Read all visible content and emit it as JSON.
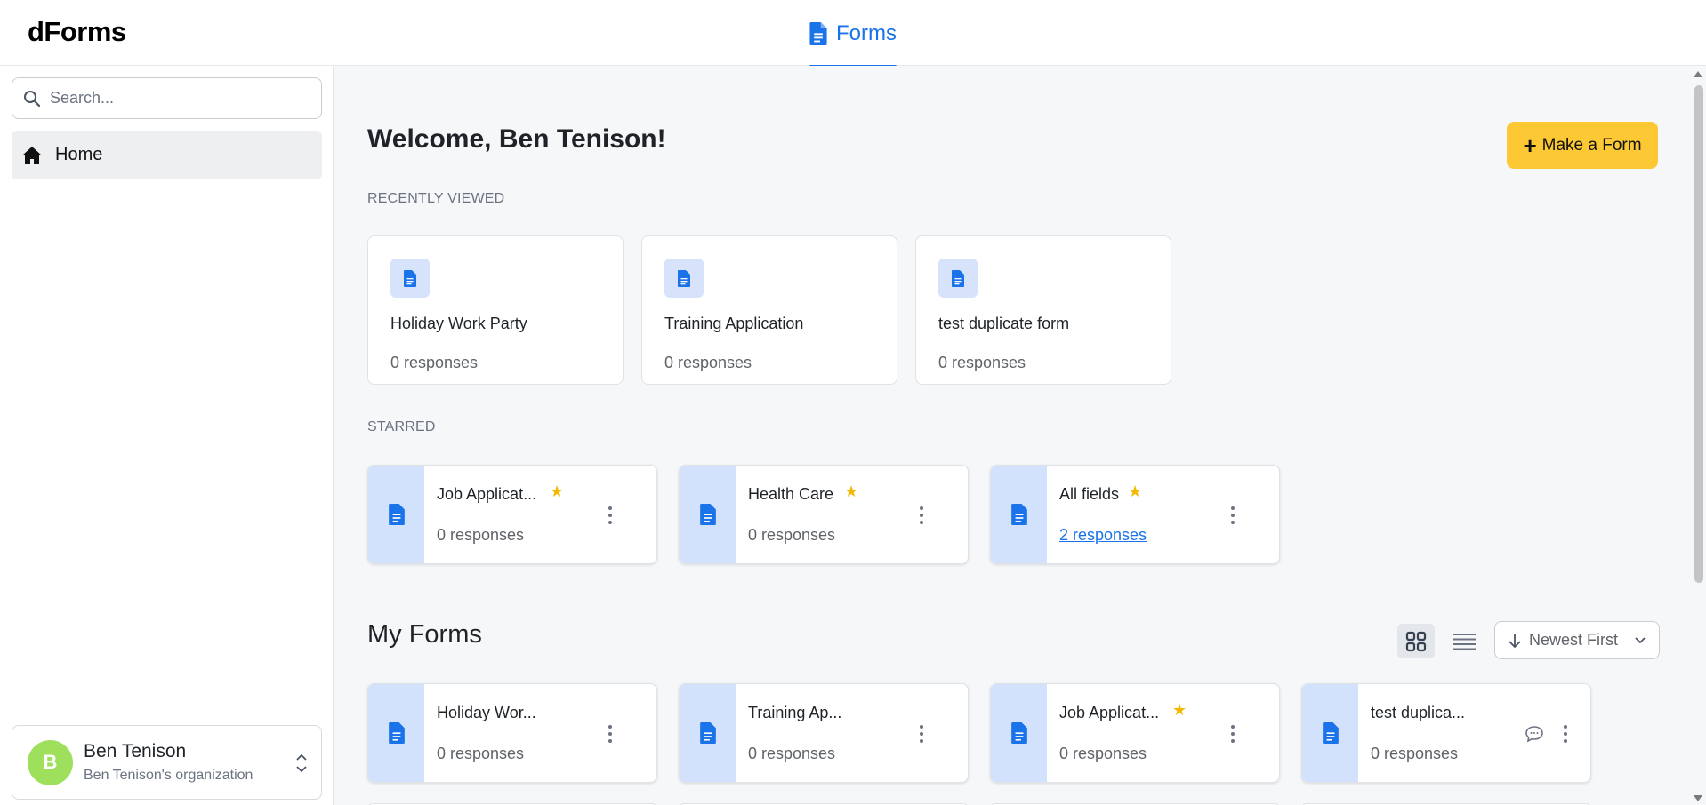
{
  "header": {
    "brand": "dForms",
    "tab_label": "Forms"
  },
  "sidebar": {
    "search_placeholder": "Search...",
    "nav_home": "Home",
    "user": {
      "initial": "B",
      "name": "Ben Tenison",
      "org": "Ben Tenison's organization"
    }
  },
  "main": {
    "welcome": "Welcome, Ben Tenison!",
    "make_form_label": "Make a Form",
    "recently_viewed_label": "RECENTLY VIEWED",
    "recent": [
      {
        "title": "Holiday Work Party",
        "responses": "0 responses"
      },
      {
        "title": "Training Application",
        "responses": "0 responses"
      },
      {
        "title": "test duplicate form",
        "responses": "0 responses"
      }
    ],
    "starred_label": "STARRED",
    "starred": [
      {
        "title": "Job Applicat...",
        "responses": "0 responses"
      },
      {
        "title": "Health Care",
        "responses": "0 responses"
      },
      {
        "title": "All fields",
        "responses": "2 responses"
      }
    ],
    "my_forms_title": "My Forms",
    "sort_label": "Newest First",
    "my_forms": [
      {
        "title": "Holiday Wor...",
        "responses": "0 responses"
      },
      {
        "title": "Training Ap...",
        "responses": "0 responses"
      },
      {
        "title": "Job Applicat...",
        "responses": "0 responses"
      },
      {
        "title": "test duplica...",
        "responses": "0 responses"
      }
    ]
  },
  "colors": {
    "accent": "#1a73e8",
    "button": "#fcc934",
    "star": "#f5b800",
    "avatar": "#9ee05b",
    "icon_bg": "#d3e2fc"
  },
  "icons": [
    "form-doc-icon",
    "search-icon",
    "home-icon",
    "star-icon",
    "kebab-icon",
    "comment-icon",
    "grid-view-icon",
    "list-view-icon",
    "arrow-down-icon",
    "chevron-down-icon",
    "chevron-updown-icon",
    "plus-icon"
  ]
}
